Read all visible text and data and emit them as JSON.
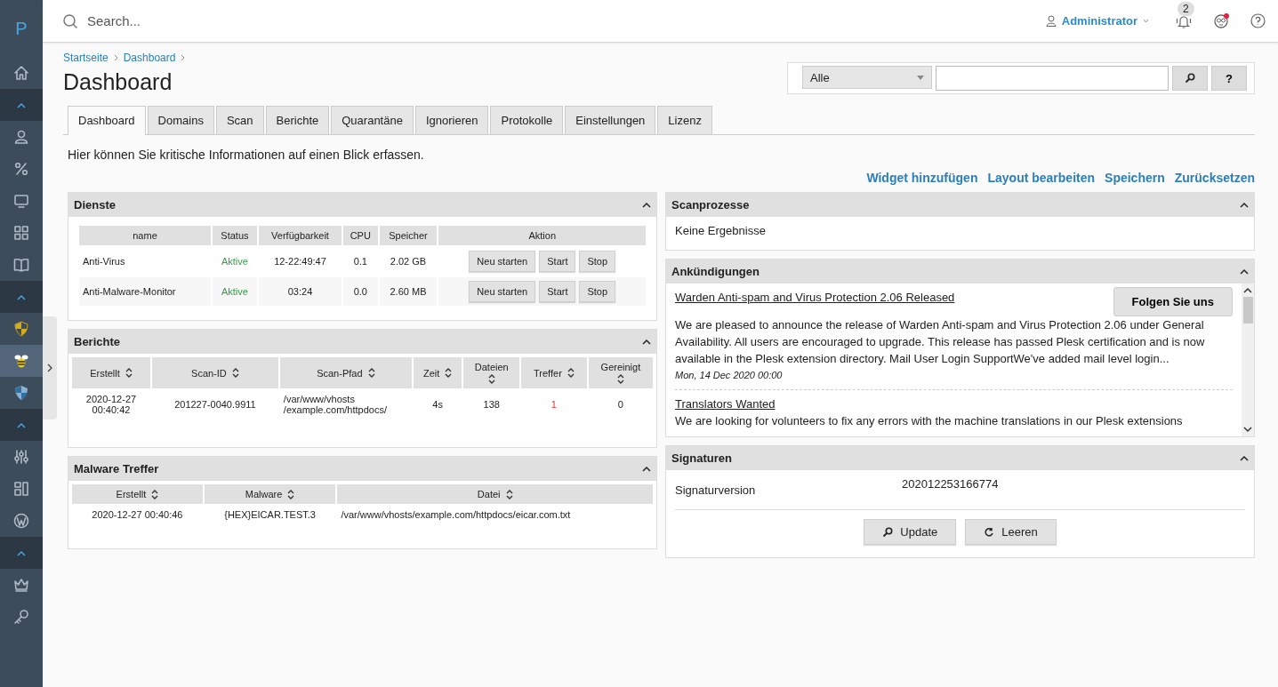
{
  "sidebar": {
    "logo": "P",
    "items": [
      {
        "kind": "nav",
        "selected": false
      },
      {
        "kind": "section-toggle"
      },
      {
        "kind": "nav",
        "selected": false
      },
      {
        "kind": "nav",
        "selected": false
      },
      {
        "kind": "nav",
        "selected": false
      },
      {
        "kind": "nav",
        "selected": false
      },
      {
        "kind": "nav",
        "selected": false
      },
      {
        "kind": "section-toggle"
      },
      {
        "kind": "nav",
        "selected": false
      },
      {
        "kind": "nav",
        "selected": true
      },
      {
        "kind": "nav",
        "selected": false
      },
      {
        "kind": "section-toggle"
      },
      {
        "kind": "nav",
        "selected": false
      },
      {
        "kind": "nav",
        "selected": false
      },
      {
        "kind": "nav",
        "selected": false
      },
      {
        "kind": "section-toggle"
      },
      {
        "kind": "nav",
        "selected": false
      },
      {
        "kind": "nav",
        "selected": false
      }
    ]
  },
  "topbar": {
    "search": {
      "placeholder": "Search..."
    },
    "user": "Administrator",
    "notification_count": "2",
    "alert": true
  },
  "breadcrumbs": [
    "Startseite",
    "Dashboard"
  ],
  "title": "Dashboard",
  "filter": {
    "select": "Alle",
    "help": "?"
  },
  "tabs": [
    {
      "label": "Dashboard",
      "selected": true
    },
    {
      "label": "Domains",
      "selected": false
    },
    {
      "label": "Scan",
      "selected": false
    },
    {
      "label": "Berichte",
      "selected": false
    },
    {
      "label": "Quarantäne",
      "selected": false
    },
    {
      "label": "Ignorieren",
      "selected": false
    },
    {
      "label": "Protokolle",
      "selected": false
    },
    {
      "label": "Einstellungen",
      "selected": false
    },
    {
      "label": "Lizenz",
      "selected": false
    }
  ],
  "description": "Hier können Sie kritische Informationen auf einen Blick erfassen.",
  "actions": [
    "Widget hinzufügen",
    "Layout bearbeiten",
    "Speichern",
    "Zurücksetzen"
  ],
  "services": {
    "title": "Dienste",
    "columns": [
      "name",
      "Status",
      "Verfügbarkeit",
      "CPU",
      "Speicher",
      "Aktion"
    ],
    "rows": [
      {
        "name": "Anti-Virus",
        "status": "Aktive",
        "uptime": "12-22:49:47",
        "cpu": "0.1",
        "memory": "2.02 GB",
        "buttons": [
          "Neu starten",
          "Start",
          "Stop"
        ]
      },
      {
        "name": "Anti-Malware-Monitor",
        "status": "Aktive",
        "uptime": "03:24",
        "cpu": "0.0",
        "memory": "2.60 MB",
        "buttons": [
          "Neu starten",
          "Start",
          "Stop"
        ]
      }
    ]
  },
  "reports": {
    "title": "Berichte",
    "columns": [
      "Erstellt",
      "Scan-ID",
      "Scan-Pfad",
      "Zeit",
      "Dateien",
      "Treffer",
      "Gereinigt"
    ],
    "rows": [
      {
        "created": "2020-12-27 00:40:42",
        "scan_id": "201227-0040.9911",
        "path": "/var/www/vhosts /example.com/httpdocs/",
        "time": "4s",
        "files": "138",
        "hits": "1",
        "hits_found": true,
        "cleaned": "0"
      }
    ]
  },
  "malware": {
    "title": "Malware Treffer",
    "columns": [
      "Erstellt",
      "Malware",
      "Datei"
    ],
    "rows": [
      {
        "created": "2020-12-27 00:40:46",
        "malware": "{HEX}EICAR.TEST.3",
        "file": "/var/www/vhosts/example.com/httpdocs/eicar.com.txt"
      }
    ]
  },
  "scans": {
    "title": "Scanprozesse",
    "empty": "Keine Ergebnisse"
  },
  "announcements": {
    "title": "Ankündigungen",
    "follow": "Folgen Sie uns",
    "items": [
      {
        "title": "Warden Anti-spam and Virus Protection 2.06 Released",
        "body": "We are pleased to announce the release of Warden Anti-spam and Virus Protection 2.06 under General Availability. All users are encouraged to upgrade. This release has passed Plesk certification and is now available in the Plesk extension directory. Mail User Login SupportWe've added mail level login...",
        "date": "Mon, 14 Dec 2020 00:00"
      },
      {
        "title": "Translators Wanted",
        "body": "We are looking for volunteers to fix any errors with the machine translations in our Plesk extensions"
      }
    ]
  },
  "signatures": {
    "title": "Signaturen",
    "label": "Signaturversion",
    "value": "202012253166774",
    "buttons": [
      "Update",
      "Leeren"
    ]
  }
}
